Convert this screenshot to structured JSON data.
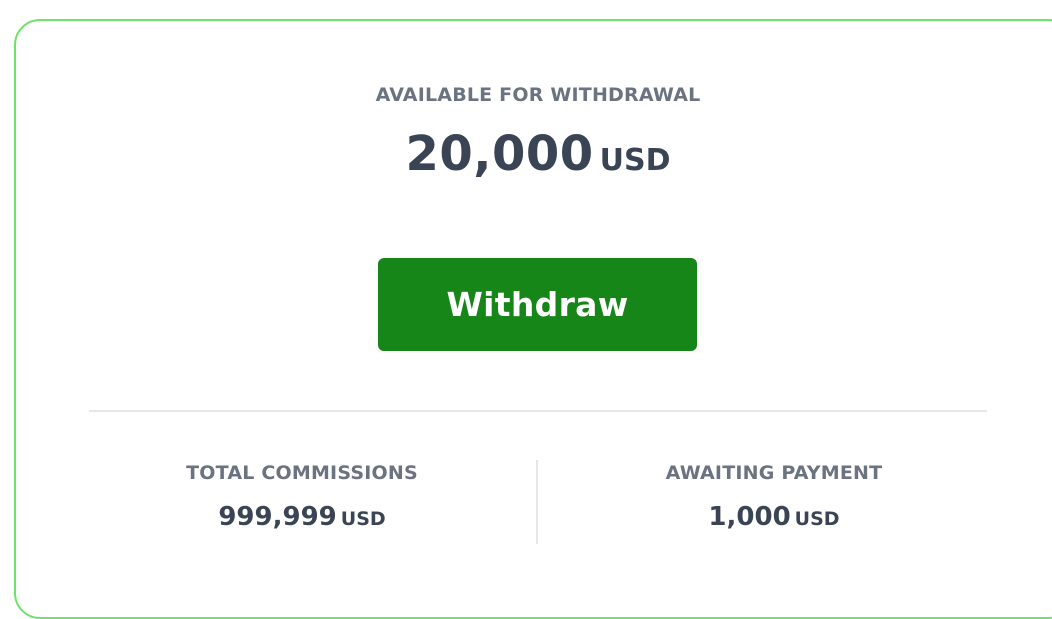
{
  "balance": {
    "label": "AVAILABLE FOR WITHDRAWAL",
    "amount": "20,000",
    "currency": "USD"
  },
  "actions": {
    "withdraw_label": "Withdraw"
  },
  "stats": {
    "total_commissions": {
      "label": "TOTAL COMMISSIONS",
      "amount": "999,999",
      "currency": "USD"
    },
    "awaiting_payment": {
      "label": "AWAITING PAYMENT",
      "amount": "1,000",
      "currency": "USD"
    }
  },
  "colors": {
    "card_border": "#6ee36a",
    "button_bg": "#168618",
    "label_text": "#6b7280",
    "value_text": "#3b4454"
  }
}
